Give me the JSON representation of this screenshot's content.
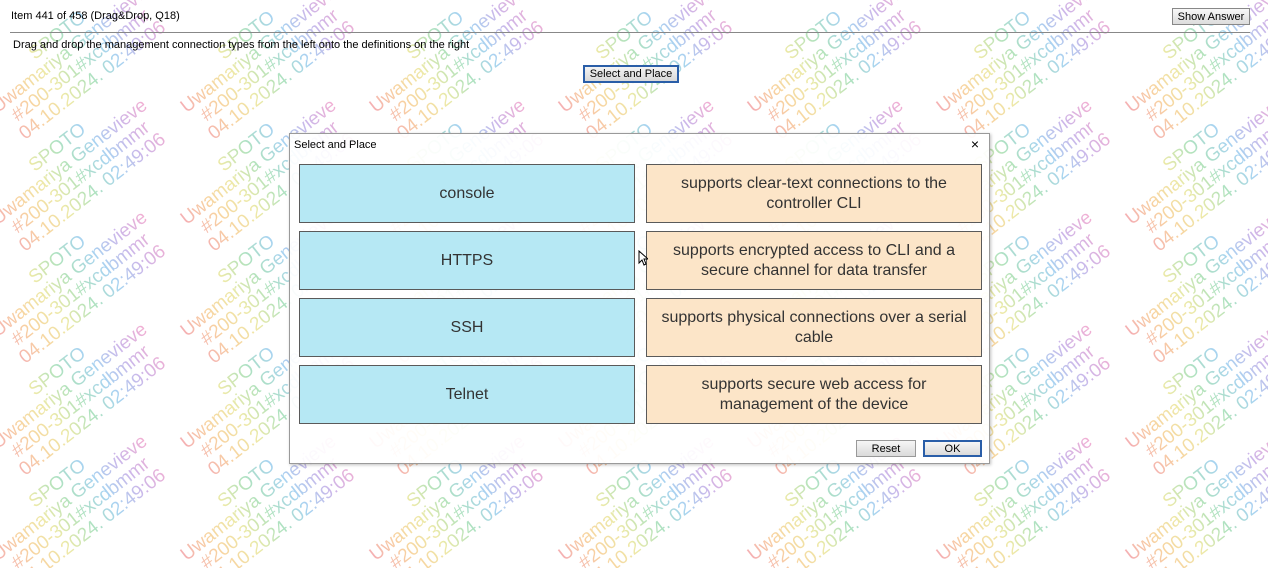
{
  "header": {
    "item_label": "Item 441 of 458  (Drag&Drop, Q18)",
    "show_answer_label": "Show Answer"
  },
  "instructions": "Drag and drop the management connection types from the left onto the definitions on the right",
  "select_and_place_button": "Select and Place",
  "dialog": {
    "title": "Select and Place",
    "close_symbol": "×",
    "sources": [
      "console",
      "HTTPS",
      "SSH",
      "Telnet"
    ],
    "targets": [
      "supports clear-text connections to the controller CLI",
      "supports encrypted access to CLI and a secure channel for data transfer",
      "supports physical connections over a serial cable",
      "supports secure web access for management of the device"
    ],
    "reset_label": "Reset",
    "ok_label": "OK"
  },
  "watermark": {
    "lines": [
      "SPOTO",
      "Uwamariya Genevieve",
      "#200-301#xcdbmmr",
      "04.10.2024. 02:49:06"
    ]
  },
  "colors": {
    "source_fill": "#b6e8f4",
    "target_fill": "#fce5c8",
    "focus_border": "#2a5ea8"
  }
}
